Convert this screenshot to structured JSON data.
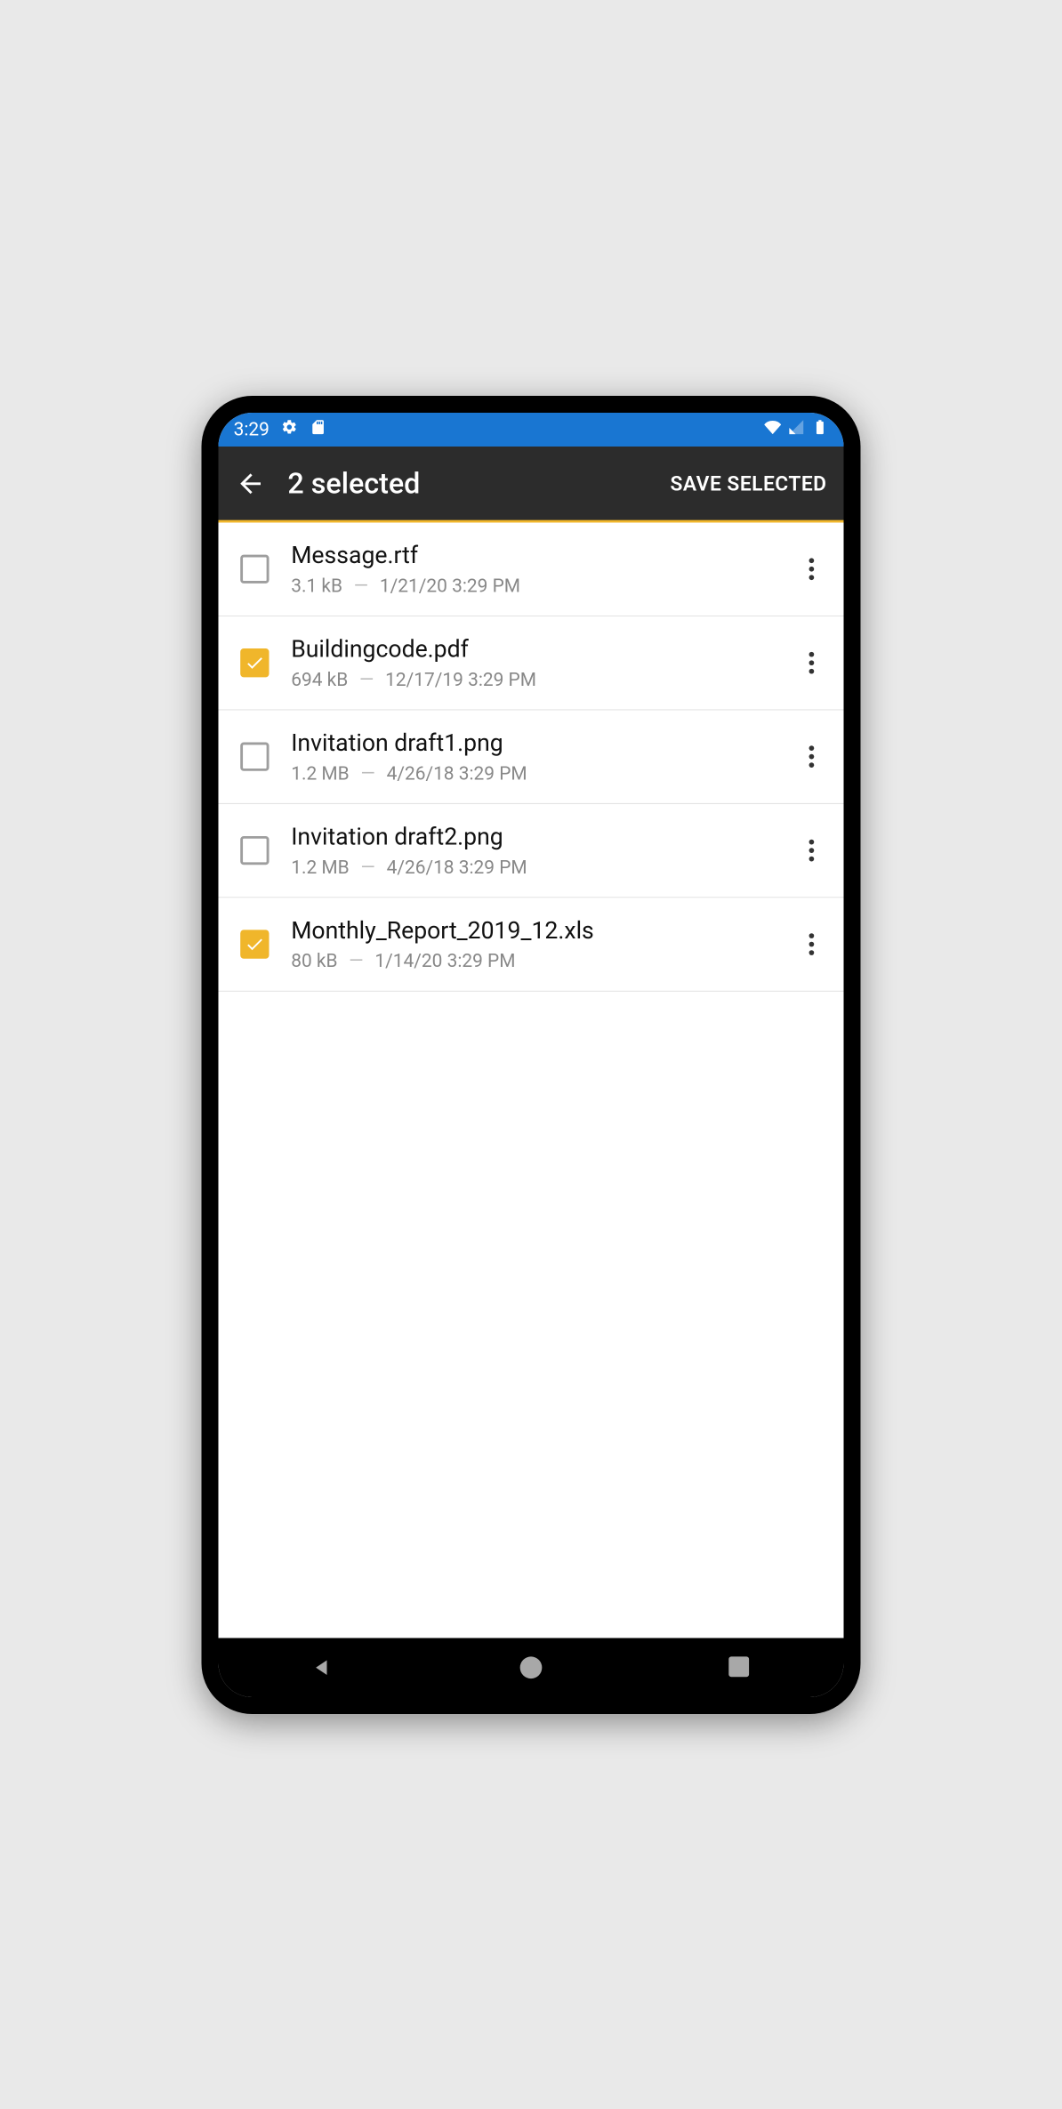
{
  "status": {
    "time": "3:29"
  },
  "appbar": {
    "title": "2 selected",
    "action": "SAVE SELECTED"
  },
  "files": [
    {
      "name": "Message.rtf",
      "size": "3.1 kB",
      "date": "1/21/20 3:29 PM",
      "checked": false
    },
    {
      "name": "Buildingcode.pdf",
      "size": "694 kB",
      "date": "12/17/19 3:29 PM",
      "checked": true
    },
    {
      "name": "Invitation draft1.png",
      "size": "1.2 MB",
      "date": "4/26/18 3:29 PM",
      "checked": false
    },
    {
      "name": "Invitation draft2.png",
      "size": "1.2 MB",
      "date": "4/26/18 3:29 PM",
      "checked": false
    },
    {
      "name": "Monthly_Report_2019_12.xls",
      "size": "80 kB",
      "date": "1/14/20 3:29 PM",
      "checked": true
    }
  ],
  "glyphs": {
    "meta_sep": "—"
  }
}
